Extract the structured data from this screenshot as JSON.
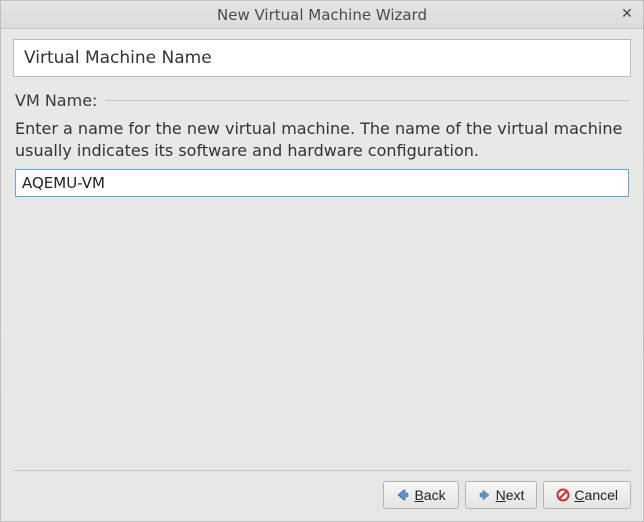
{
  "window": {
    "title": "New Virtual Machine Wizard"
  },
  "step": {
    "header": "Virtual Machine Name"
  },
  "group": {
    "title": "VM Name:",
    "description": "Enter a name for the new virtual machine. The name of the virtual machine usually indicates its software and hardware configuration."
  },
  "input": {
    "vm_name": "AQEMU-VM"
  },
  "buttons": {
    "back": {
      "mnemonic": "B",
      "rest": "ack"
    },
    "next": {
      "mnemonic": "N",
      "rest": "ext"
    },
    "cancel": {
      "mnemonic": "C",
      "rest": "ancel"
    }
  }
}
